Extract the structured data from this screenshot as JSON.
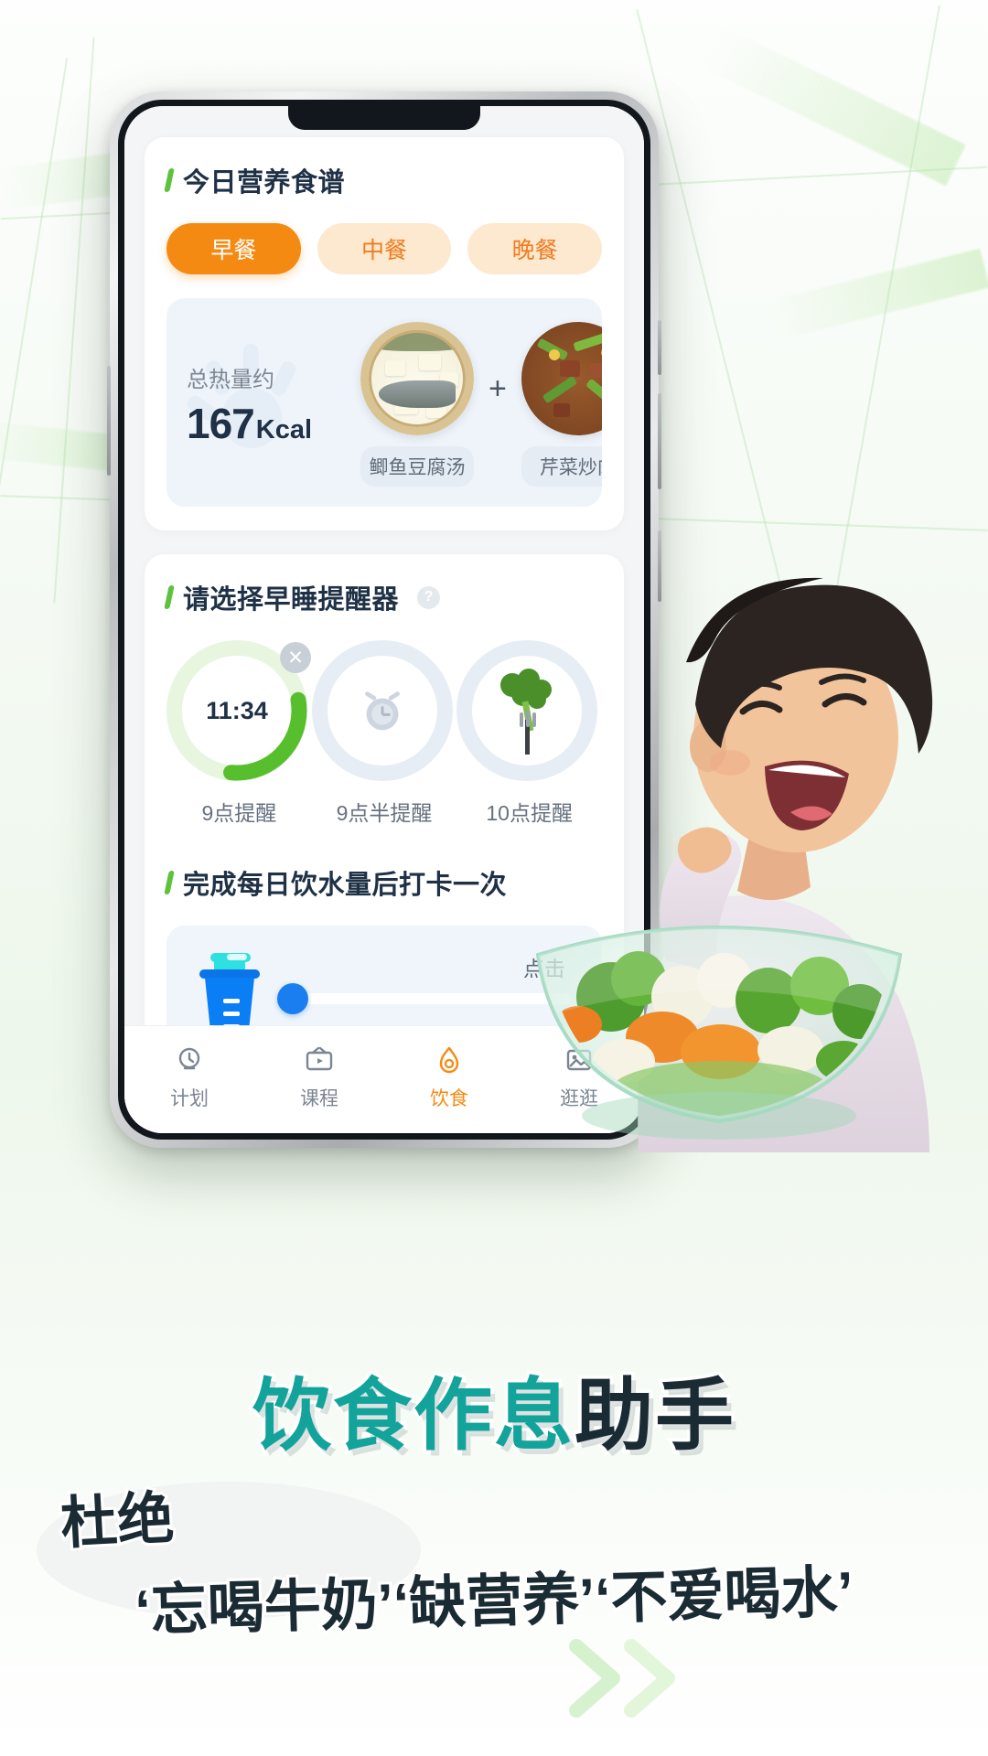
{
  "app": {
    "nutrition_section": {
      "title": "今日营养食谱",
      "meal_tabs": [
        {
          "label": "早餐",
          "active": true
        },
        {
          "label": "中餐",
          "active": false
        },
        {
          "label": "晚餐",
          "active": false
        }
      ],
      "calorie_card": {
        "label": "总热量约",
        "value": "167",
        "unit": "Kcal",
        "separator": "+",
        "dishes": [
          {
            "name": "鲫鱼豆腐汤",
            "icon": "fish-tofu-soup-image"
          },
          {
            "name": "芹菜炒肉",
            "icon": "celery-pork-stirfry-image"
          }
        ]
      }
    },
    "sleep_section": {
      "title": "请选择早睡提醒器",
      "help_icon": "question-mark-icon",
      "reminders": [
        {
          "label": "9点提醒",
          "time": "11:34",
          "selected": true,
          "icon": "progress-ring",
          "close_icon": "close-icon"
        },
        {
          "label": "9点半提醒",
          "time": "",
          "selected": false,
          "icon": "alarm-clock-icon"
        },
        {
          "label": "10点提醒",
          "time": "",
          "selected": false,
          "icon": "broccoli-fork-icon"
        }
      ]
    },
    "water_section": {
      "title": "完成每日饮水量后打卡一次",
      "bottle_icon": "water-bottle-icon",
      "cta": "点击",
      "slider_value": 0
    },
    "tabbar": [
      {
        "label": "计划",
        "icon": "plan-icon",
        "active": false
      },
      {
        "label": "课程",
        "icon": "course-icon",
        "active": false
      },
      {
        "label": "饮食",
        "icon": "diet-flame-icon",
        "active": true
      },
      {
        "label": "逛逛",
        "icon": "browse-image-icon",
        "active": false
      }
    ]
  },
  "promo": {
    "headline_teal": "饮食作息",
    "headline_dark": "助手",
    "sub_left": "杜绝",
    "sub_right": "‘忘喝牛奶’‘缺营养’‘不爱喝水’"
  },
  "colors": {
    "accent_orange": "#f58a12",
    "accent_green": "#5cc33c",
    "teal": "#12a39a",
    "dark_navy": "#1f3146",
    "water_blue": "#1a7ef0"
  }
}
